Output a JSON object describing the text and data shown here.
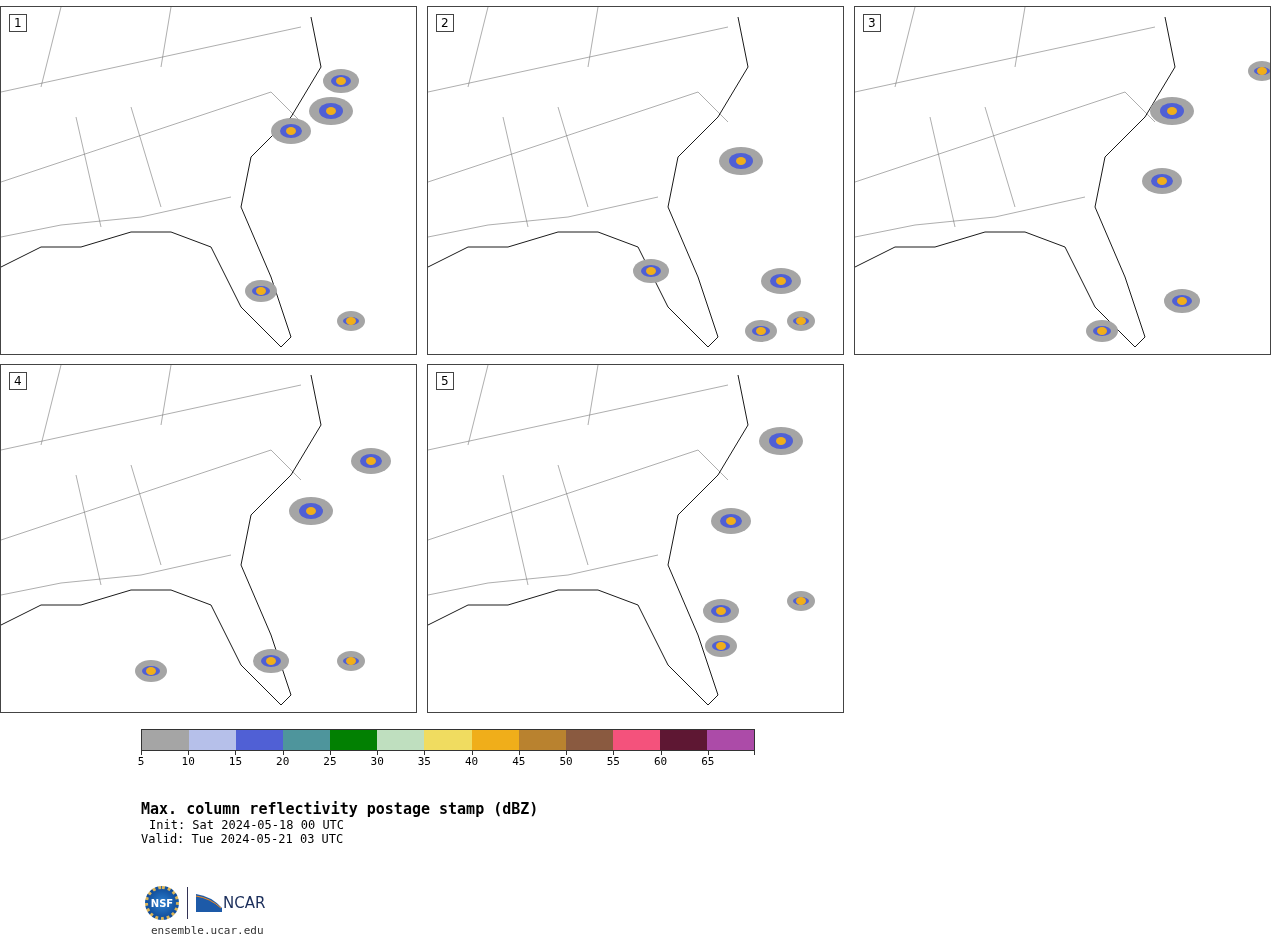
{
  "panels": [
    {
      "number": "1"
    },
    {
      "number": "2"
    },
    {
      "number": "3"
    },
    {
      "number": "4"
    },
    {
      "number": "5"
    }
  ],
  "colorbar": {
    "bins": [
      {
        "color": "#a5a5a5"
      },
      {
        "color": "#b6c0ea"
      },
      {
        "color": "#5060d5"
      },
      {
        "color": "#4e959c"
      },
      {
        "color": "#028002"
      },
      {
        "color": "#bfdfbf"
      },
      {
        "color": "#f0dc60"
      },
      {
        "color": "#f0ae1a"
      },
      {
        "color": "#b9822f"
      },
      {
        "color": "#8a5a40"
      },
      {
        "color": "#f4527c"
      },
      {
        "color": "#5e1733"
      },
      {
        "color": "#ac4ba8"
      }
    ],
    "ticks": [
      "5",
      "10",
      "15",
      "20",
      "25",
      "30",
      "35",
      "40",
      "45",
      "50",
      "55",
      "60",
      "65"
    ]
  },
  "title": "Max. column reflectivity postage stamp (dBZ)",
  "init": "Init: Sat 2024-05-18 00 UTC",
  "valid": "Valid: Tue 2024-05-21 03 UTC",
  "logo": {
    "nsf": "NSF",
    "ncar": "NCAR",
    "url": "ensemble.ucar.edu"
  }
}
